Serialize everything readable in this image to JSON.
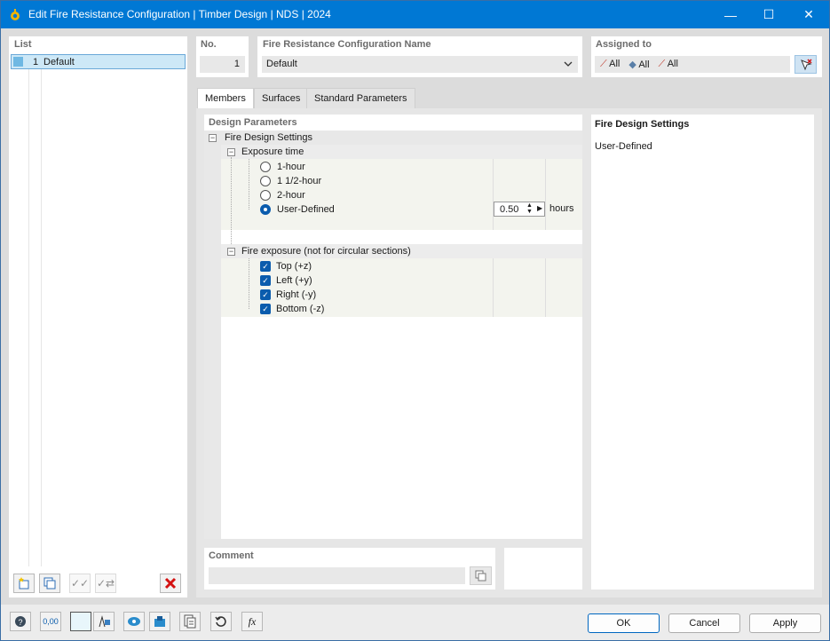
{
  "window": {
    "title": "Edit Fire Resistance Configuration | Timber Design | NDS | 2024",
    "minimize_glyph": "—",
    "maximize_glyph": "☐",
    "close_glyph": "✕"
  },
  "list": {
    "header": "List",
    "items": [
      {
        "no": "1",
        "name": "Default"
      }
    ]
  },
  "header": {
    "no_label": "No.",
    "no_value": "1",
    "name_label": "Fire Resistance Configuration Name",
    "name_value": "Default",
    "assigned_label": "Assigned to",
    "assigned_items": [
      "All",
      "All",
      "All"
    ]
  },
  "tabs": [
    "Members",
    "Surfaces",
    "Standard Parameters"
  ],
  "design_params": {
    "header": "Design Parameters",
    "fire_design_settings": "Fire Design Settings",
    "exposure_time": "Exposure time",
    "exposure_options": [
      "1-hour",
      "1 1/2-hour",
      "2-hour",
      "User-Defined"
    ],
    "selected_option": "User-Defined",
    "user_value": "0.50",
    "user_unit": "hours",
    "fire_exposure": "Fire exposure (not for circular sections)",
    "exposure_sides": [
      "Top (+z)",
      "Left (+y)",
      "Right (-y)",
      "Bottom (-z)"
    ]
  },
  "info_panel": {
    "title": "Fire Design Settings",
    "text": "User-Defined"
  },
  "comment": {
    "label": "Comment",
    "value": ""
  },
  "buttons": {
    "ok": "OK",
    "cancel": "Cancel",
    "apply": "Apply"
  },
  "colors": {
    "titlebar": "#0078d4",
    "accent": "#0b5cad",
    "selection": "#cde8f7"
  },
  "icons": {
    "delete": "red-x-icon",
    "help": "help-icon",
    "units": "units-icon"
  }
}
